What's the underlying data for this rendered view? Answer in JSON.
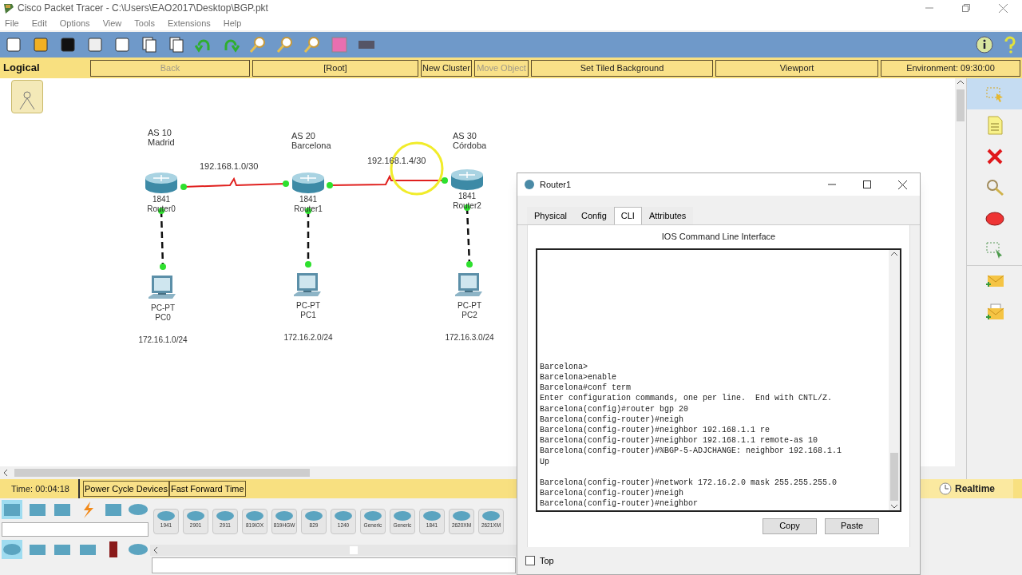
{
  "window": {
    "title": "Cisco Packet Tracer - C:\\Users\\EAO2017\\Desktop\\BGP.pkt"
  },
  "menu": [
    "File",
    "Edit",
    "Options",
    "View",
    "Tools",
    "Extensions",
    "Help"
  ],
  "nav_bar": {
    "label": "Logical",
    "buttons": [
      {
        "label": "Back",
        "disabled": true
      },
      {
        "label": "[Root]",
        "disabled": false
      },
      {
        "label": "New Cluster",
        "disabled": false
      },
      {
        "label": "Move Object",
        "disabled": true
      },
      {
        "label": "Set Tiled Background",
        "disabled": false
      },
      {
        "label": "Viewport",
        "disabled": false
      },
      {
        "label": "Environment: 09:30:00",
        "disabled": false
      }
    ]
  },
  "canvas": {
    "areas": [
      {
        "as": "AS 10",
        "city": "Madrid"
      },
      {
        "as": "AS 20",
        "city": "Barcelona"
      },
      {
        "as": "AS 30",
        "city": "Córdoba"
      }
    ],
    "wan_links": [
      "192.168.1.0/30",
      "192.168.1.4/30"
    ],
    "routers": [
      {
        "model": "1841",
        "name": "Router0"
      },
      {
        "model": "1841",
        "name": "Router1"
      },
      {
        "model": "1841",
        "name": "Router2"
      }
    ],
    "pcs": [
      {
        "model": "PC-PT",
        "name": "PC0",
        "network": "172.16.1.0/24"
      },
      {
        "model": "PC-PT",
        "name": "PC1",
        "network": "172.16.2.0/24"
      },
      {
        "model": "PC-PT",
        "name": "PC2",
        "network": "172.16.3.0/24"
      }
    ]
  },
  "tools": [
    {
      "kind": "select",
      "selected": true
    },
    {
      "kind": "note",
      "selected": false
    },
    {
      "kind": "delete",
      "selected": false
    },
    {
      "kind": "inspect",
      "selected": false
    },
    {
      "kind": "shape",
      "selected": false
    },
    {
      "kind": "resize",
      "selected": false
    },
    {
      "kind": "pdu",
      "selected": false
    },
    {
      "kind": "complex-pdu",
      "selected": false
    }
  ],
  "time_bar": {
    "time": "Time: 00:04:18",
    "buttons": [
      "Power Cycle Devices",
      "Fast Forward Time"
    ],
    "mode": "Realtime"
  },
  "device_models": [
    "1941",
    "2901",
    "2911",
    "819IOX",
    "819HGW",
    "829",
    "1240",
    "Generic",
    "Generic",
    "1841",
    "2620XM",
    "2621XM"
  ],
  "dialog": {
    "title": "Router1",
    "tabs": [
      {
        "label": "Physical",
        "selected": false
      },
      {
        "label": "Config",
        "selected": false
      },
      {
        "label": "CLI",
        "selected": true
      },
      {
        "label": "Attributes",
        "selected": false
      }
    ],
    "heading": "IOS Command Line Interface",
    "cli_blocks": [
      [
        "Barcelona>",
        "Barcelona>enable",
        "Barcelona#conf term",
        "Enter configuration commands, one per line.  End with CNTL/Z.",
        "Barcelona(config)#router bgp 20",
        "Barcelona(config-router)#neigh",
        "Barcelona(config-router)#neighbor 192.168.1.1 re",
        "Barcelona(config-router)#neighbor 192.168.1.1 remote-as 10",
        "Barcelona(config-router)#%BGP-5-ADJCHANGE: neighbor 192.168.1.1",
        "Up"
      ],
      [
        "Barcelona(config-router)#network 172.16.2.0 mask 255.255.255.0",
        "Barcelona(config-router)#neigh",
        "Barcelona(config-router)#neighbor"
      ]
    ],
    "buttons": [
      "Copy",
      "Paste"
    ],
    "top": {
      "label": "Top",
      "checked": false
    }
  }
}
